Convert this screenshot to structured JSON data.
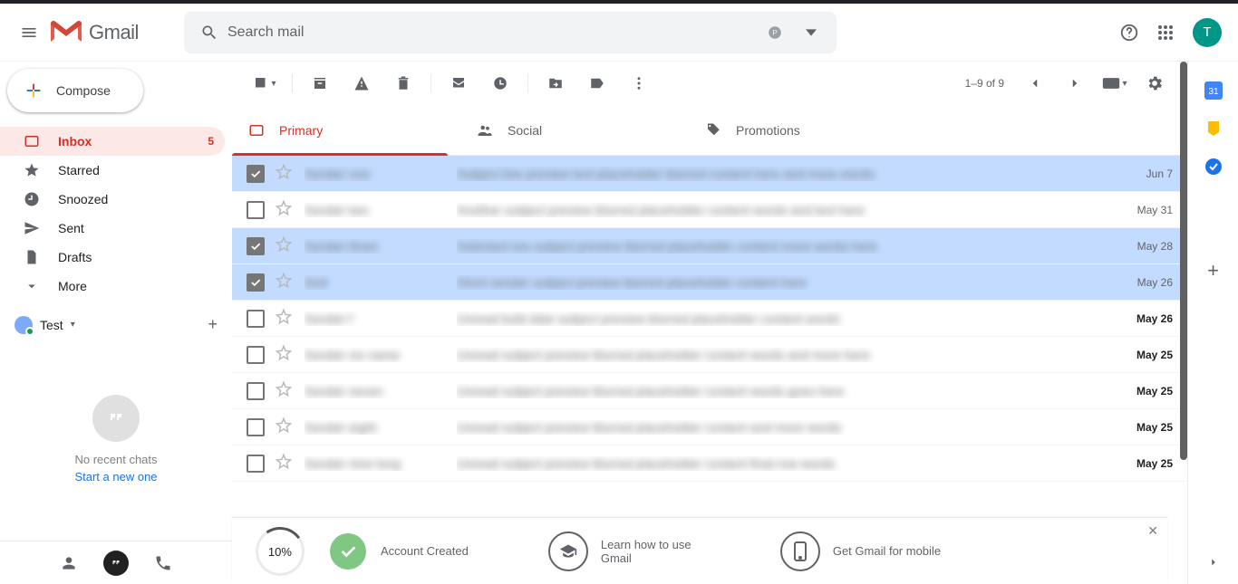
{
  "header": {
    "brand": "Gmail",
    "search_placeholder": "Search mail",
    "avatar_letter": "T"
  },
  "sidebar": {
    "compose_label": "Compose",
    "items": [
      {
        "label": "Inbox",
        "count": "5"
      },
      {
        "label": "Starred"
      },
      {
        "label": "Snoozed"
      },
      {
        "label": "Sent"
      },
      {
        "label": "Drafts"
      },
      {
        "label": "More"
      }
    ],
    "chat_user": "Test",
    "no_chats": "No recent chats",
    "start_new": "Start a new one"
  },
  "toolbar": {
    "count_text": "1–9 of 9"
  },
  "tabs": {
    "primary": "Primary",
    "social": "Social",
    "promotions": "Promotions"
  },
  "emails": [
    {
      "selected": true,
      "unread": false,
      "sender": "Sender one",
      "subject": "Subject line preview text placeholder blurred content here and more words",
      "date": "Jun 7"
    },
    {
      "selected": false,
      "unread": false,
      "sender": "Sender two",
      "subject": "Another subject preview blurred placeholder content words and text here",
      "date": "May 31"
    },
    {
      "selected": true,
      "unread": false,
      "sender": "Sender three",
      "subject": "Selected row subject preview blurred placeholder content more words here",
      "date": "May 28"
    },
    {
      "selected": true,
      "unread": false,
      "sender": "Snd",
      "subject": "Short sender subject preview blurred placeholder content here",
      "date": "May 26"
    },
    {
      "selected": false,
      "unread": true,
      "sender": "Sender f",
      "subject": "Unread bold date subject preview blurred placeholder content words",
      "date": "May 26"
    },
    {
      "selected": false,
      "unread": true,
      "sender": "Sender six name",
      "subject": "Unread subject preview blurred placeholder content words and more here",
      "date": "May 25"
    },
    {
      "selected": false,
      "unread": true,
      "sender": "Sender seven",
      "subject": "Unread subject preview blurred placeholder content words goes here",
      "date": "May 25"
    },
    {
      "selected": false,
      "unread": true,
      "sender": "Sender eight",
      "subject": "Unread subject preview blurred placeholder content and more words",
      "date": "May 25"
    },
    {
      "selected": false,
      "unread": true,
      "sender": "Sender nine long",
      "subject": "Unread subject preview blurred placeholder content final row words",
      "date": "May 25"
    }
  ],
  "setup": {
    "progress": "10%",
    "created": "Account Created",
    "learn": "Learn how to use Gmail",
    "mobile": "Get Gmail for mobile"
  }
}
